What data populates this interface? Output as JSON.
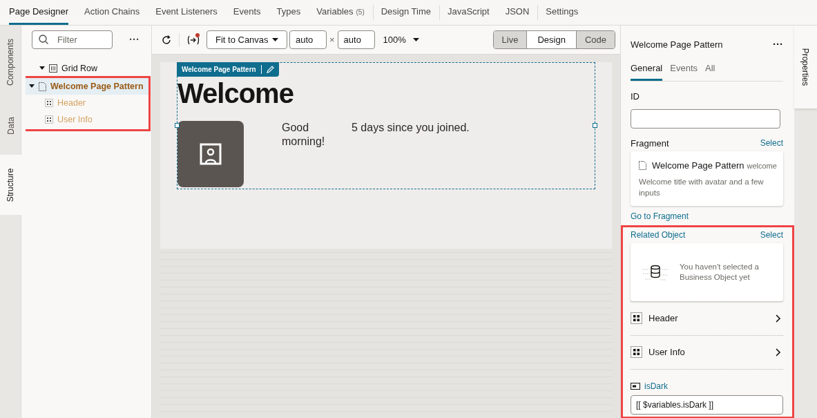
{
  "top_tabs": [
    {
      "label": "Page Designer",
      "selected": true
    },
    {
      "label": "Action Chains",
      "selected": false
    },
    {
      "label": "Event Listeners",
      "selected": false
    },
    {
      "label": "Events",
      "selected": false
    },
    {
      "label": "Types",
      "selected": false
    },
    {
      "label": "Variables",
      "count": "(5)",
      "selected": false,
      "divider_after": true
    },
    {
      "label": "Design Time",
      "selected": false,
      "divider_after": true
    },
    {
      "label": "JavaScript",
      "selected": false
    },
    {
      "label": "JSON",
      "selected": false,
      "divider_after": true
    },
    {
      "label": "Settings",
      "selected": false
    }
  ],
  "left_tabs": [
    {
      "label": "Components",
      "selected": false
    },
    {
      "label": "Data",
      "selected": false
    },
    {
      "label": "Structure",
      "selected": true
    }
  ],
  "structure": {
    "filter_placeholder": "Filter",
    "more": "···",
    "highlighted": true,
    "tree": [
      {
        "label": "Grid Row",
        "kind": "grid",
        "expanded": true,
        "selected": false,
        "children": [
          {
            "label": "Welcome Page Pattern",
            "kind": "fragment",
            "expanded": true,
            "selected": true,
            "children": [
              {
                "label": "Header",
                "kind": "slot",
                "selected": false
              },
              {
                "label": "User Info",
                "kind": "slot",
                "selected": false
              }
            ]
          }
        ]
      }
    ]
  },
  "toolbar": {
    "fit": "Fit to Canvas",
    "width": "auto",
    "times": "×",
    "height": "auto",
    "zoom": "100%",
    "variable_alert": true,
    "modes": [
      {
        "label": "Live",
        "selected": false
      },
      {
        "label": "Design",
        "selected": true
      },
      {
        "label": "Code",
        "selected": false
      }
    ]
  },
  "canvas": {
    "badge": "Welcome Page Pattern",
    "heading": "Welcome",
    "greeting": "Good morning!",
    "joined": "5 days since you joined."
  },
  "properties": {
    "tab_label": "Properties",
    "title": "Welcome Page Pattern",
    "more": "···",
    "tabs": [
      {
        "label": "General",
        "selected": true
      },
      {
        "label": "Events",
        "selected": false
      },
      {
        "label": "All",
        "selected": false
      }
    ],
    "id_label": "ID",
    "fragment_label": "Fragment",
    "fragment_select": "Select",
    "fragment": {
      "name": "Welcome Page Pattern",
      "id": "welcome",
      "description": "Welcome title with avatar and a few inputs"
    },
    "go_to": "Go to Fragment",
    "related": {
      "highlighted": true,
      "label": "Related Object",
      "select": "Select",
      "empty": "You haven't selected a Business Object yet",
      "slots": [
        {
          "label": "Header"
        },
        {
          "label": "User Info"
        }
      ],
      "param_label": "isDark",
      "param_value": "[[ $variables.isDark ]]"
    }
  }
}
